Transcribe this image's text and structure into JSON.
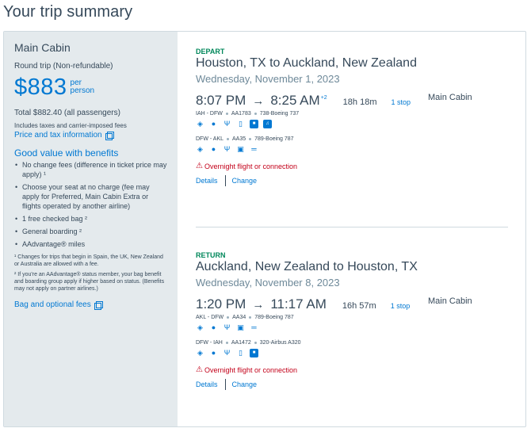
{
  "page_title": "Your trip summary",
  "sidebar": {
    "cabin_title": "Main Cabin",
    "trip_type": "Round trip (Non-refundable)",
    "price": "$883",
    "per": "per",
    "person": "person",
    "total": "Total $882.40 (all passengers)",
    "includes": "Includes taxes and carrier-imposed fees",
    "price_tax_link": "Price and tax information",
    "benefits_title": "Good value with benefits",
    "benefits": [
      "No change fees (difference in ticket price may apply) ¹",
      "Choose your seat at no charge (fee may apply for Preferred, Main Cabin Extra or flights operated by another airline)",
      "1 free checked bag ²",
      "General boarding ²",
      "AAdvantage® miles"
    ],
    "footnote1": "¹ Changes for trips that begin in Spain, the UK, New Zealand or Australia are allowed with a fee.",
    "footnote2": "² If you're an AAdvantage® status member, your bag benefit and boarding group apply if higher based on status. (Benefits may not apply on partner airlines.)",
    "bag_link": "Bag and optional fees"
  },
  "depart": {
    "label": "DEPART",
    "route": "Houston, TX to Auckland, New Zealand",
    "date": "Wednesday, November 1, 2023",
    "depart_time": "8:07 PM",
    "arrow": "→",
    "arrive_time": "8:25 AM",
    "plus_day": "+2",
    "duration": "18h 18m",
    "stops": "1 stop",
    "cabin": "Main Cabin",
    "segments": [
      {
        "route": "IAH - DFW",
        "flight": "AA1783",
        "aircraft": "738-Boeing 737",
        "amenities": [
          "wifi-icon",
          "power-icon",
          "usb-icon",
          "phone-icon",
          "tv-icon",
          "music-icon"
        ]
      },
      {
        "route": "DFW - AKL",
        "flight": "AA35",
        "aircraft": "789-Boeing 787",
        "amenities": [
          "wifi-icon",
          "power-icon",
          "usb-icon",
          "meal-icon",
          "flatbed-icon"
        ]
      }
    ],
    "warning": "Overnight flight or connection",
    "details": "Details",
    "change": "Change"
  },
  "return": {
    "label": "RETURN",
    "route": "Auckland, New Zealand to Houston, TX",
    "date": "Wednesday, November 8, 2023",
    "depart_time": "1:20 PM",
    "arrow": "→",
    "arrive_time": "11:17 AM",
    "duration": "16h 57m",
    "stops": "1 stop",
    "cabin": "Main Cabin",
    "segments": [
      {
        "route": "AKL - DFW",
        "flight": "AA34",
        "aircraft": "789-Boeing 787",
        "amenities": [
          "wifi-icon",
          "power-icon",
          "usb-icon",
          "meal-icon",
          "flatbed-icon"
        ]
      },
      {
        "route": "DFW - IAH",
        "flight": "AA1472",
        "aircraft": "320-Airbus A320",
        "amenities": [
          "wifi-icon",
          "power-icon",
          "usb-icon",
          "phone-icon",
          "tv-icon"
        ]
      }
    ],
    "warning": "Overnight flight or connection",
    "details": "Details",
    "change": "Change"
  },
  "colors": {
    "accent": "#0078d2",
    "success": "#00875a",
    "warning": "#c30019",
    "sidebar_bg": "#e4eaed"
  }
}
